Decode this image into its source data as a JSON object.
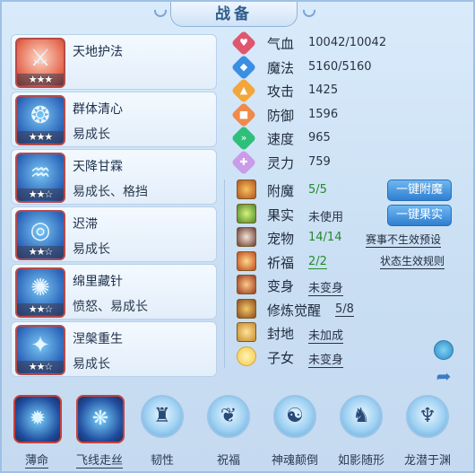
{
  "title": "战备",
  "skills": [
    {
      "name": "天地护法",
      "tags": "",
      "stars": "★★★",
      "icon": "sword-icon"
    },
    {
      "name": "群体清心",
      "tags": "易成长",
      "stars": "★★★",
      "icon": "spirit-icon"
    },
    {
      "name": "天降甘霖",
      "tags": "易成长、格挡",
      "stars": "★★☆",
      "icon": "rain-icon"
    },
    {
      "name": "迟滞",
      "tags": "易成长",
      "stars": "★★☆",
      "icon": "slow-icon"
    },
    {
      "name": "绵里藏针",
      "tags": "愤怒、易成长",
      "stars": "★★☆",
      "icon": "needle-icon"
    },
    {
      "name": "涅槃重生",
      "tags": "易成长",
      "stars": "★★☆",
      "icon": "rebirth-icon"
    }
  ],
  "stats": [
    {
      "label": "气血",
      "value": "10042/10042",
      "color": "#e0566f",
      "icon": "heart-icon"
    },
    {
      "label": "魔法",
      "value": "5160/5160",
      "color": "#3b8fe3",
      "icon": "diamond-icon"
    },
    {
      "label": "攻击",
      "value": "1425",
      "color": "#f3a63a",
      "icon": "attack-icon"
    },
    {
      "label": "防御",
      "value": "1596",
      "color": "#f08a4b",
      "icon": "shield-icon"
    },
    {
      "label": "速度",
      "value": "965",
      "color": "#2fbf7b",
      "icon": "speed-icon"
    },
    {
      "label": "灵力",
      "value": "759",
      "color": "#c99be8",
      "icon": "spirit-power-icon"
    }
  ],
  "equip": {
    "enchant": {
      "label": "附魔",
      "value": "5/5"
    },
    "fruit": {
      "label": "果实",
      "value": "未使用"
    },
    "pet": {
      "label": "宠物",
      "value": "14/14"
    },
    "blessing": {
      "label": "祈福",
      "value": "2/2"
    },
    "transform": {
      "label": "变身",
      "value": "未变身"
    },
    "cultivation": {
      "label": "修炼觉醒",
      "value": "5/8"
    },
    "seal": {
      "label": "封地",
      "value": "未加成"
    },
    "child": {
      "label": "子女",
      "value": "未变身"
    }
  },
  "buttons": {
    "enchant": "一键附魔",
    "fruit": "一键果实"
  },
  "links": {
    "pet_preset": "赛事不生效预设",
    "status_rules": "状态生效规则"
  },
  "bottom": [
    {
      "label": "薄命",
      "icon": "star-burst-icon",
      "active": true
    },
    {
      "label": "飞线走丝",
      "icon": "silk-icon",
      "active": true
    },
    {
      "label": "韧性",
      "icon": "golem-icon",
      "active": false
    },
    {
      "label": "祝福",
      "icon": "blessing-icon",
      "active": false
    },
    {
      "label": "神魂颠倒",
      "icon": "soul-icon",
      "active": false
    },
    {
      "label": "如影随形",
      "icon": "shadow-icon",
      "active": false
    },
    {
      "label": "龙潜于渊",
      "icon": "dragon-icon",
      "active": false
    }
  ]
}
